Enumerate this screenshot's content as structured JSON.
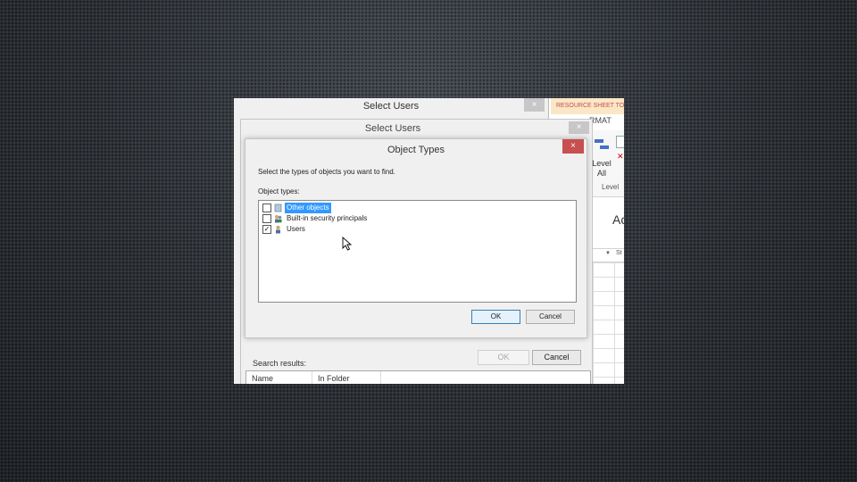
{
  "background_app": {
    "ribbon_tab_tools": "RESOURCE SHEET TO",
    "ribbon_tab_format": "RMAT",
    "level_button_label": "Level All",
    "level_group_label": "Level",
    "cell_text": "Ac",
    "formula_cell": "St"
  },
  "select_users_window": {
    "title": "Select Users",
    "close_label": "×"
  },
  "select_users_dialog": {
    "title": "Select Users",
    "close_label": "×",
    "search_results_label": "Search results:",
    "columns": [
      "Name",
      "In Folder"
    ],
    "ok_label": "OK",
    "cancel_label": "Cancel"
  },
  "object_types_dialog": {
    "title": "Object Types",
    "close_label": "×",
    "instruction": "Select the types of objects you want to find.",
    "object_types_label": "Object types:",
    "items": [
      {
        "label": "Other objects",
        "checked": false,
        "selected": true,
        "icon": "folder-icon"
      },
      {
        "label": "Built-in security principals",
        "checked": false,
        "selected": false,
        "icon": "group-icon"
      },
      {
        "label": "Users",
        "checked": true,
        "selected": false,
        "icon": "user-icon"
      }
    ],
    "ok_label": "OK",
    "cancel_label": "Cancel"
  },
  "colors": {
    "close_active": "#c75050",
    "selection": "#3399ff",
    "accent_tab": "#fbe7c6"
  }
}
